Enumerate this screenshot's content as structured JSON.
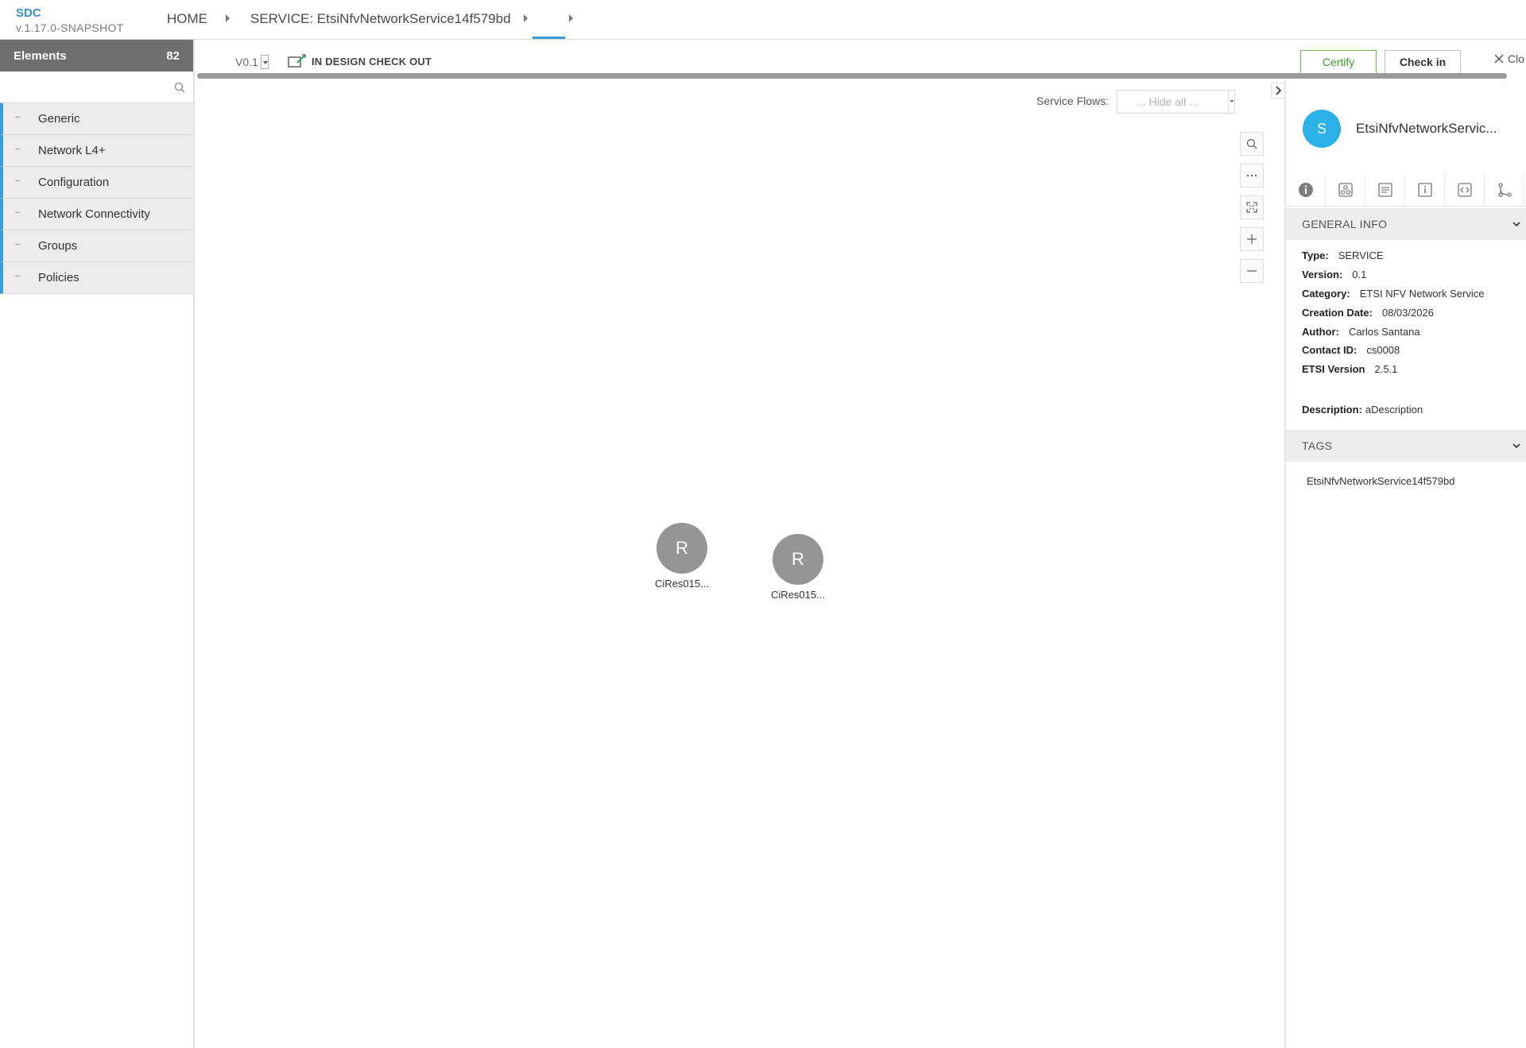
{
  "header": {
    "brand": "SDC",
    "version": "v.1.17.0-SNAPSHOT",
    "breadcrumbs": [
      "HOME",
      "SERVICE: EtsiNfvNetworkService14f579bd",
      ""
    ]
  },
  "palette": {
    "title": "Elements",
    "count": "82",
    "search_placeholder": "",
    "categories": [
      "Generic",
      "Network L4+",
      "Configuration",
      "Network Connectivity",
      "Groups",
      "Policies"
    ]
  },
  "toolbar": {
    "version": "V0.1",
    "status": "IN DESIGN CHECK OUT",
    "certify_label": "Certify",
    "checkin_label": "Check in",
    "close_label": "Clo"
  },
  "canvas": {
    "service_flows_label": "Service Flows:",
    "service_flows_value": "... Hide all ...",
    "nodes": [
      {
        "letter": "R",
        "label": "CiRes015..."
      },
      {
        "letter": "R",
        "label": "CiRes015..."
      }
    ],
    "tools": [
      "search-icon",
      "more-icon",
      "fit-icon",
      "zoom-in-icon",
      "zoom-out-icon"
    ]
  },
  "details": {
    "avatar_letter": "S",
    "title": "EtsiNfvNetworkServic...",
    "tabs": [
      "info-icon",
      "composition-icon",
      "deployment-artifacts-icon",
      "properties-icon",
      "api-icon",
      "distribution-icon"
    ],
    "general_info_title": "GENERAL INFO",
    "fields": [
      {
        "key": "Type:",
        "value": "SERVICE"
      },
      {
        "key": "Version:",
        "value": "0.1"
      },
      {
        "key": "Category:",
        "value": "ETSI NFV Network Service"
      },
      {
        "key": "Creation Date:",
        "value": "08/03/2026"
      },
      {
        "key": "Author:",
        "value": "Carlos Santana"
      },
      {
        "key": "Contact ID:",
        "value": "cs0008"
      },
      {
        "key": "ETSI Version",
        "value": "2.5.1"
      }
    ],
    "description_key": "Description:",
    "description_value": "aDescription",
    "tags_title": "TAGS",
    "tags": [
      "EtsiNfvNetworkService14f579bd"
    ]
  }
}
